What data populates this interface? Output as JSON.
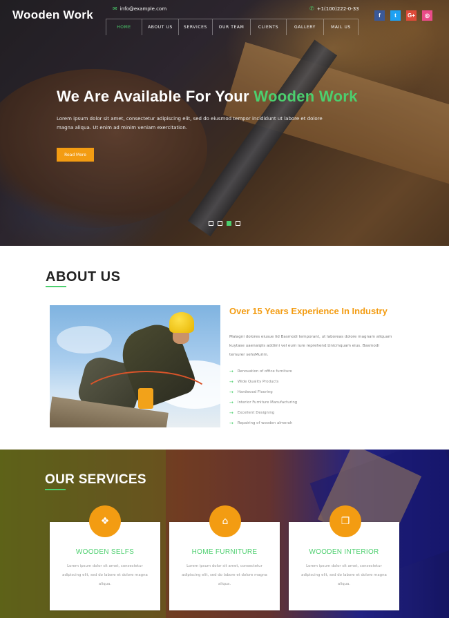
{
  "header": {
    "logo": "Wooden Work",
    "email": "info@example.com",
    "phone": "+1(100)222-0-33",
    "social": [
      {
        "icon": "facebook-icon",
        "glyph": "f",
        "color": "#3b5998"
      },
      {
        "icon": "twitter-icon",
        "glyph": "t",
        "color": "#1da1f2"
      },
      {
        "icon": "google-plus-icon",
        "glyph": "G+",
        "color": "#dd4b39"
      },
      {
        "icon": "dribbble-icon",
        "glyph": "◎",
        "color": "#ea4c89"
      }
    ],
    "nav": [
      "HOME",
      "ABOUT US",
      "SERVICES",
      "OUR TEAM",
      "CLIENTS",
      "GALLERY",
      "MAIL US"
    ],
    "active_nav": "HOME"
  },
  "hero": {
    "title_main": "We Are Available For Your ",
    "title_accent": "Wooden Work",
    "text": "Lorem ipsum dolor sit amet, consectetur adipiscing elit, sed do eiusmod tempor incididunt ut labore et dolore magna aliqua. Ut enim ad minim veniam exercitation.",
    "button": "Read More",
    "slides": 4,
    "active_slide": 3
  },
  "about": {
    "title": "ABOUT US",
    "heading": "Over 15 Years Experience In Industry",
    "paragraph": "Malagni dolores eiusue lid Basmodi temporant, ut laboreas dolore magnam aliquam kuytase uaenaiqiis addimi vel eum iure reprehend.Unicmquam eius. Basmodi temurer sehsMurim.",
    "list": [
      "Renovation of office furniture",
      "Wide Quality Products",
      "Hardwood Flooring",
      "Interior Furniture Manufacturing",
      "Excellent Designing",
      "Repairing of wooden almerah"
    ]
  },
  "services": {
    "title": "OUR SERVICES",
    "cards": [
      {
        "icon": "cubes-icon",
        "glyph": "❖",
        "title": "WOODEN SELFS",
        "text": "Lorem ipsum dolor sit amet, consectetur adipiscing elit, sed do labore et dolore magna aliqua."
      },
      {
        "icon": "home-icon",
        "glyph": "⌂",
        "title": "HOME FURNITURE",
        "text": "Lorem ipsum dolor sit amet, consectetur adipiscing elit, sed do labore et dolore magna aliqua."
      },
      {
        "icon": "copy-icon",
        "glyph": "❐",
        "title": "WOODEN INTERIOR",
        "text": "Lorem ipsum dolor sit amet, consectetur adipiscing elit, sed do labore et dolore magna aliqua."
      }
    ]
  },
  "colors": {
    "accent_green": "#4ccf6e",
    "accent_orange": "#f39c12"
  }
}
